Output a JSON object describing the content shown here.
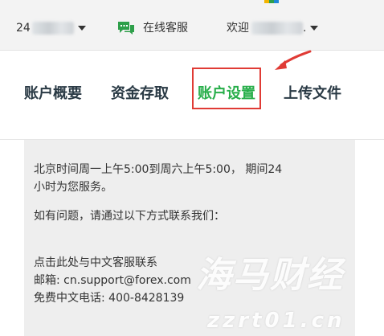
{
  "topbar": {
    "account_number_prefix": "24",
    "support_label": "在线客服",
    "welcome_label": "欢迎",
    "welcome_suffix": "."
  },
  "tabs": [
    {
      "label": "账户概要",
      "active": false
    },
    {
      "label": "资金存取",
      "active": false
    },
    {
      "label": "账户设置",
      "active": true
    },
    {
      "label": "上传文件",
      "active": false
    }
  ],
  "content": {
    "hours_line1": "北京时间周一上午5:00到周六上午5:00， 期间24",
    "hours_line2": "小时为您服务。",
    "contact_intro": "如有问题，请通过以下方式联系我们：",
    "chinese_support_link": "点击此处与中文客服联系",
    "email_label": "邮箱: ",
    "email_value": "cn.support@forex.com",
    "phone_label": "免费中文电话: ",
    "phone_value": "400-8428139"
  },
  "watermark": {
    "chinese": "海马财经",
    "url": "zzrt01.cn"
  },
  "colors": {
    "active_tab": "#27ae4a",
    "tab_text": "#2a3a45",
    "highlight_box": "#e03b35",
    "chat_icon": "#2e9f4a",
    "topbar_bg": "#f3f3f3",
    "content_bg": "#eeeeee"
  },
  "icons": {
    "support": "chat-bubbles-icon",
    "dropdown": "caret-down-icon",
    "annotation": "red-arrow-icon"
  }
}
